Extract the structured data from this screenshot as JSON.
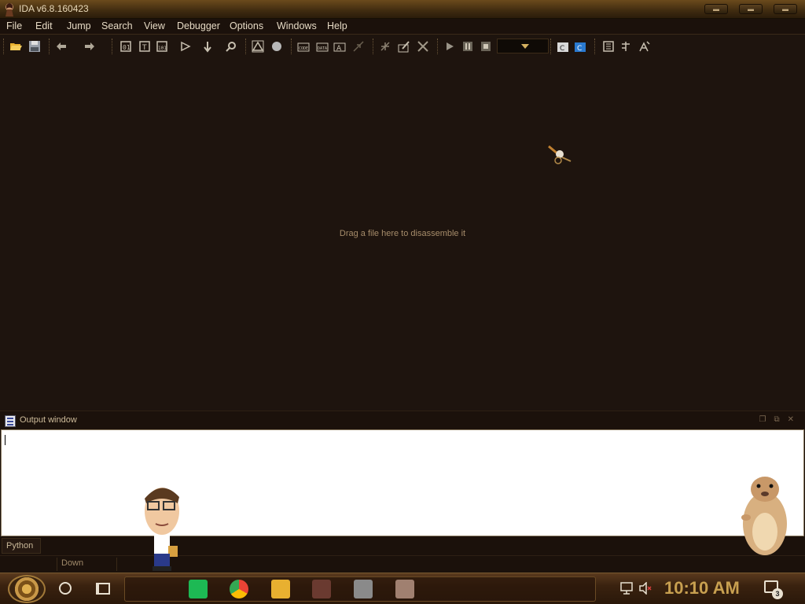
{
  "window": {
    "title": "IDA v6.8.160423"
  },
  "menu": [
    "File",
    "Edit",
    "Jump",
    "Search",
    "View",
    "Debugger",
    "Options",
    "Windows",
    "Help"
  ],
  "main": {
    "hint": "Drag a file here to disassemble it"
  },
  "output": {
    "title": "Output window",
    "content": ""
  },
  "command": {
    "language": "Python"
  },
  "status": {
    "state": "Down"
  },
  "taskbar": {
    "time": "10:10 AM",
    "notification_count": "3"
  },
  "colors": {
    "accent": "#c8a050",
    "background": "#1e140e",
    "menu_text": "#e6dac4"
  },
  "icons": {
    "toolbar": [
      "open-icon",
      "save-icon",
      "back-icon",
      "forward-icon",
      "debugger-run-icon",
      "pause-icon",
      "stop-icon"
    ],
    "tray": [
      "network-icon",
      "volume-muted-icon",
      "notifications-icon"
    ]
  }
}
